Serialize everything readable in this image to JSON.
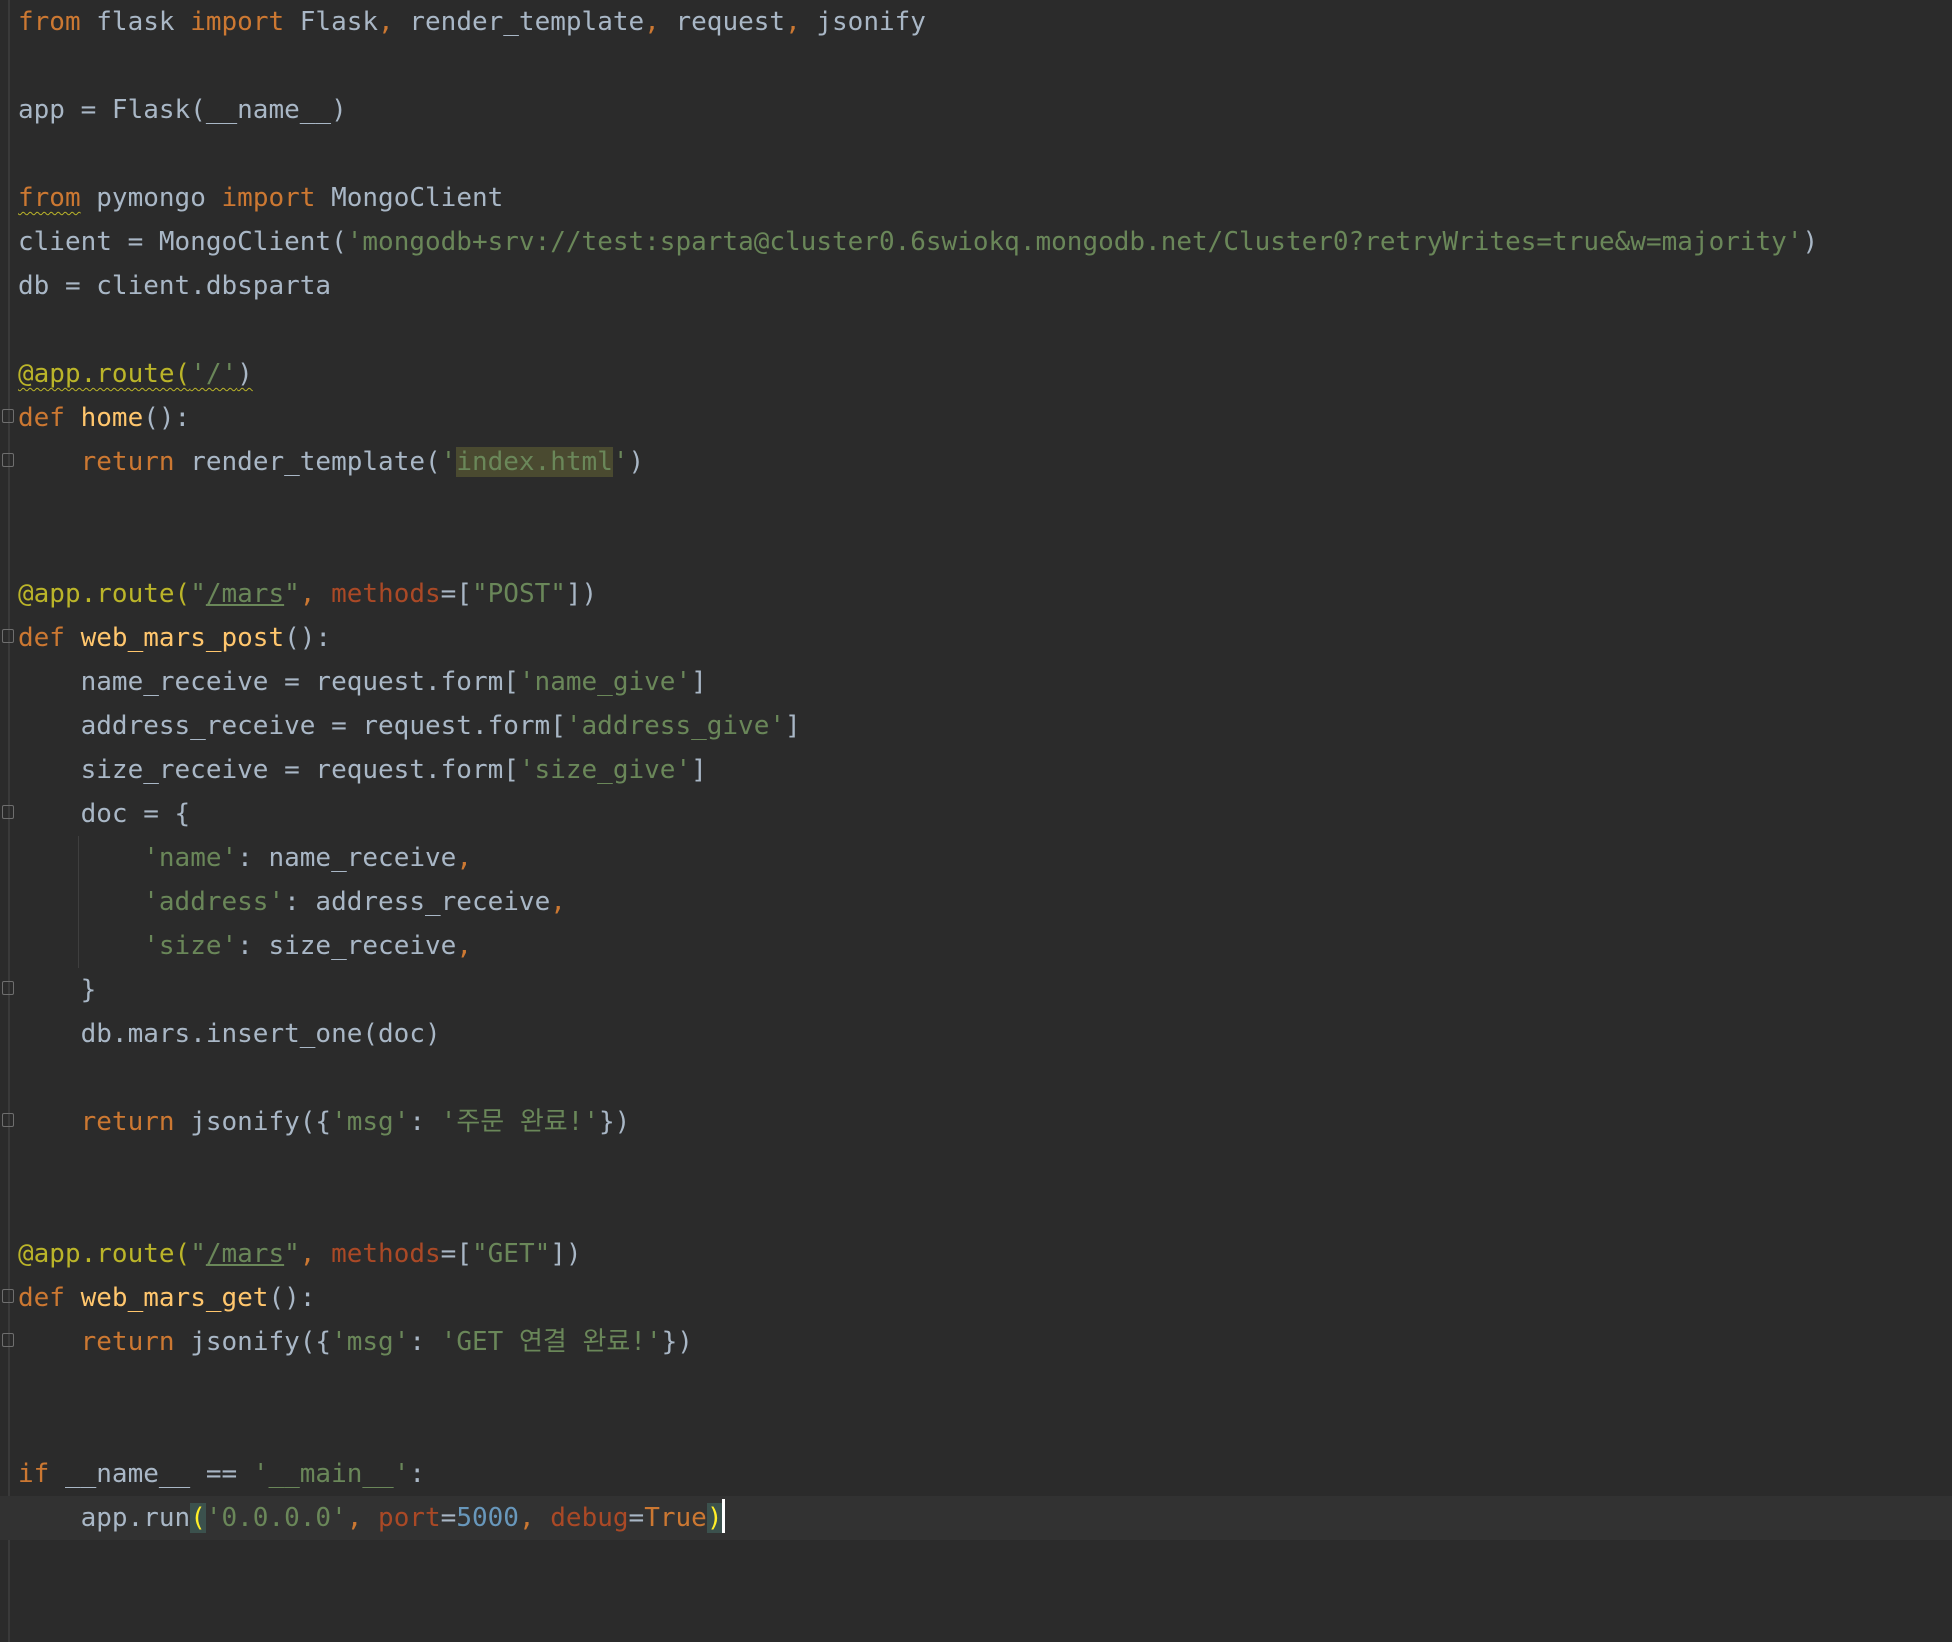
{
  "editor": {
    "lines": [
      [
        {
          "t": "from",
          "c": "kw"
        },
        {
          "t": " flask "
        },
        {
          "t": "import",
          "c": "kw"
        },
        {
          "t": " Flask"
        },
        {
          "t": ", ",
          "c": "kw"
        },
        {
          "t": "render_template"
        },
        {
          "t": ", ",
          "c": "kw"
        },
        {
          "t": "request"
        },
        {
          "t": ", ",
          "c": "kw"
        },
        {
          "t": "jsonify"
        }
      ],
      [],
      [
        {
          "t": "app = Flask(__name__)"
        }
      ],
      [],
      [
        {
          "t": "from",
          "c": "kw squig"
        },
        {
          "t": " pymongo "
        },
        {
          "t": "import",
          "c": "kw"
        },
        {
          "t": " MongoClient"
        }
      ],
      [
        {
          "t": "client = MongoClient("
        },
        {
          "t": "'mongodb+srv://test:sparta@cluster0.6swiokq.mongodb.net/Cluster0?retryWrites=true&w=majority'",
          "c": "str"
        },
        {
          "t": ")"
        }
      ],
      [
        {
          "t": "db = client.dbsparta"
        }
      ],
      [],
      [
        {
          "t": "@app.route(",
          "c": "dec squig"
        },
        {
          "t": "'/'",
          "c": "str squig"
        },
        {
          "t": ")",
          "c": "squig"
        }
      ],
      [
        {
          "t": "def",
          "c": "kw"
        },
        {
          "t": " "
        },
        {
          "t": "home",
          "c": "fn"
        },
        {
          "t": "():"
        }
      ],
      [
        {
          "t": "    "
        },
        {
          "t": "return",
          "c": "kw"
        },
        {
          "t": " render_template("
        },
        {
          "t": "'",
          "c": "str"
        },
        {
          "t": "index.html",
          "c": "str hl-str"
        },
        {
          "t": "'",
          "c": "str"
        },
        {
          "t": ")"
        }
      ],
      [],
      [],
      [
        {
          "t": "@app.route(",
          "c": "dec"
        },
        {
          "t": "\"",
          "c": "str"
        },
        {
          "t": "/mars",
          "c": "str link"
        },
        {
          "t": "\"",
          "c": "str"
        },
        {
          "t": ", ",
          "c": "kw"
        },
        {
          "t": "methods",
          "c": "param"
        },
        {
          "t": "=["
        },
        {
          "t": "\"POST\"",
          "c": "str"
        },
        {
          "t": "])"
        }
      ],
      [
        {
          "t": "def",
          "c": "kw"
        },
        {
          "t": " "
        },
        {
          "t": "web_mars_post",
          "c": "fn"
        },
        {
          "t": "():"
        }
      ],
      [
        {
          "t": "    name_receive = request.form["
        },
        {
          "t": "'name_give'",
          "c": "str"
        },
        {
          "t": "]"
        }
      ],
      [
        {
          "t": "    address_receive = request.form["
        },
        {
          "t": "'address_give'",
          "c": "str"
        },
        {
          "t": "]"
        }
      ],
      [
        {
          "t": "    size_receive = request.form["
        },
        {
          "t": "'size_give'",
          "c": "str"
        },
        {
          "t": "]"
        }
      ],
      [
        {
          "t": "    doc = {"
        }
      ],
      [
        {
          "t": "        "
        },
        {
          "t": "'name'",
          "c": "str"
        },
        {
          "t": ": name_receive"
        },
        {
          "t": ",",
          "c": "kw"
        }
      ],
      [
        {
          "t": "        "
        },
        {
          "t": "'address'",
          "c": "str"
        },
        {
          "t": ": address_receive"
        },
        {
          "t": ",",
          "c": "kw"
        }
      ],
      [
        {
          "t": "        "
        },
        {
          "t": "'size'",
          "c": "str"
        },
        {
          "t": ": size_receive"
        },
        {
          "t": ",",
          "c": "kw"
        }
      ],
      [
        {
          "t": "    }"
        }
      ],
      [
        {
          "t": "    db.mars.insert_one(doc)"
        }
      ],
      [],
      [
        {
          "t": "    "
        },
        {
          "t": "return",
          "c": "kw"
        },
        {
          "t": " jsonify({"
        },
        {
          "t": "'msg'",
          "c": "str"
        },
        {
          "t": ": "
        },
        {
          "t": "'주문 완료!'",
          "c": "str"
        },
        {
          "t": "})"
        }
      ],
      [],
      [],
      [
        {
          "t": "@app.route(",
          "c": "dec"
        },
        {
          "t": "\"",
          "c": "str"
        },
        {
          "t": "/mars",
          "c": "str link"
        },
        {
          "t": "\"",
          "c": "str"
        },
        {
          "t": ", ",
          "c": "kw"
        },
        {
          "t": "methods",
          "c": "param"
        },
        {
          "t": "=["
        },
        {
          "t": "\"GET\"",
          "c": "str"
        },
        {
          "t": "])"
        }
      ],
      [
        {
          "t": "def",
          "c": "kw"
        },
        {
          "t": " "
        },
        {
          "t": "web_mars_get",
          "c": "fn"
        },
        {
          "t": "():"
        }
      ],
      [
        {
          "t": "    "
        },
        {
          "t": "return",
          "c": "kw"
        },
        {
          "t": " jsonify({"
        },
        {
          "t": "'msg'",
          "c": "str"
        },
        {
          "t": ": "
        },
        {
          "t": "'GET 연결 완료!'",
          "c": "str"
        },
        {
          "t": "})"
        }
      ],
      [],
      [],
      [
        {
          "t": "if",
          "c": "kw"
        },
        {
          "t": " __name__ == "
        },
        {
          "t": "'__main__'",
          "c": "str"
        },
        {
          "t": ":"
        }
      ],
      [
        {
          "t": "    app.run"
        },
        {
          "t": "(",
          "c": "brace-match"
        },
        {
          "t": "'0.0.0.0'",
          "c": "str"
        },
        {
          "t": ", ",
          "c": "kw"
        },
        {
          "t": "port",
          "c": "param"
        },
        {
          "t": "="
        },
        {
          "t": "5000",
          "c": "num"
        },
        {
          "t": ", ",
          "c": "kw"
        },
        {
          "t": "debug",
          "c": "param"
        },
        {
          "t": "="
        },
        {
          "t": "True",
          "c": "kw"
        },
        {
          "t": ")",
          "c": "brace-match"
        }
      ]
    ]
  },
  "colors": {
    "background": "#2b2b2b",
    "keyword": "#cc7832",
    "string": "#6a8759",
    "decorator": "#bbb529",
    "function": "#ffc66d",
    "number": "#6897bb",
    "parameter": "#aa4926",
    "text": "#a9b7c6"
  }
}
